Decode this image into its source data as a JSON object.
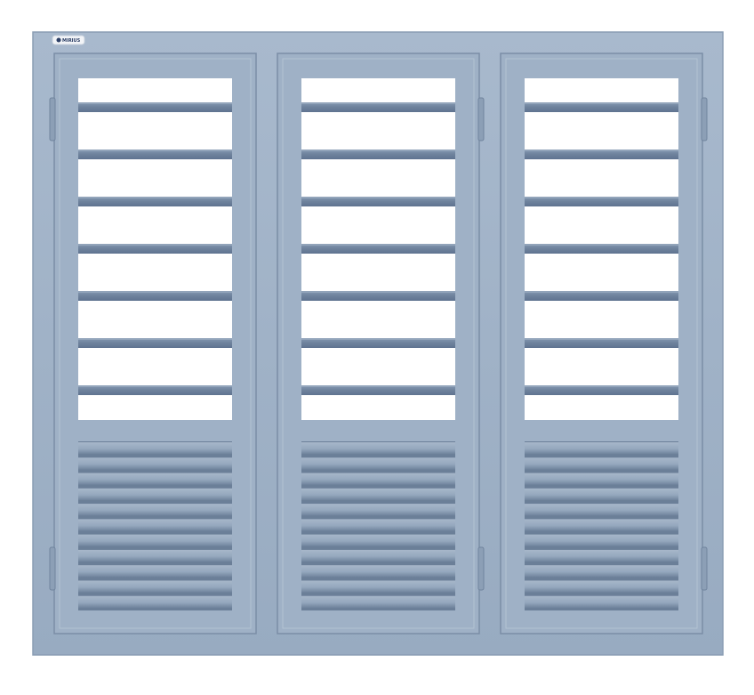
{
  "product": {
    "type": "three-panel louvered steel window",
    "panel_count": 3,
    "upper_slat_count": 7,
    "lower_louver_count": 11
  },
  "logo": {
    "text": "MIRIUS"
  },
  "colors": {
    "frame": "#9fb1c6",
    "frame_shadow": "#7b8ea6",
    "slat": "#6e829c",
    "slat_highlight": "#b3c2d3",
    "glass": "#ffffff",
    "louver": "#8fa2b9",
    "louver_shadow": "#6b7f98",
    "logo_badge": "#f2f4f7",
    "logo_ink": "#2c3f66"
  }
}
